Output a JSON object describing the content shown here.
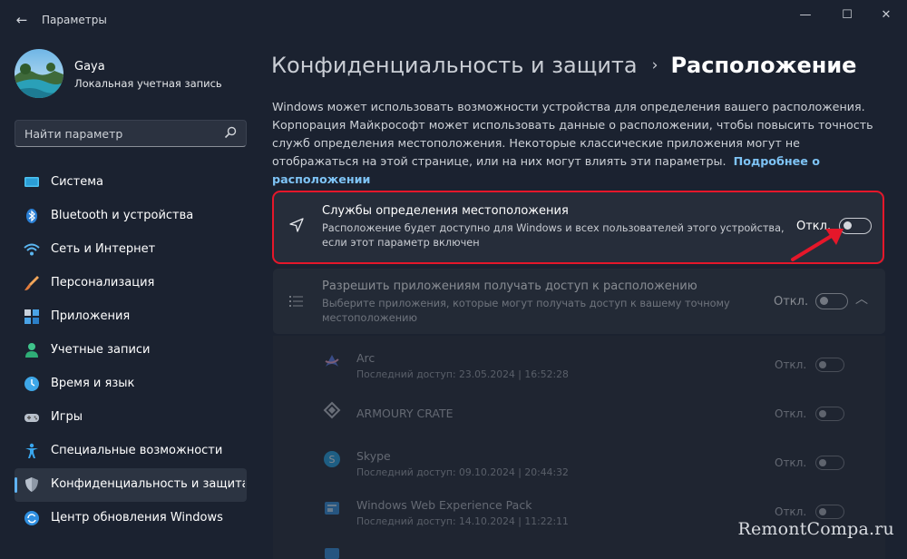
{
  "window": {
    "title": "Параметры",
    "controls": {
      "minimize": "—",
      "maximize": "☐",
      "close": "✕"
    }
  },
  "user": {
    "name": "Gaya",
    "account_type": "Локальная учетная запись"
  },
  "search": {
    "placeholder": "Найти параметр"
  },
  "sidebar": {
    "items": [
      {
        "label": "Система",
        "icon": "monitor-icon"
      },
      {
        "label": "Bluetooth и устройства",
        "icon": "bluetooth-icon"
      },
      {
        "label": "Сеть и Интернет",
        "icon": "wifi-icon"
      },
      {
        "label": "Персонализация",
        "icon": "brush-icon"
      },
      {
        "label": "Приложения",
        "icon": "apps-icon"
      },
      {
        "label": "Учетные записи",
        "icon": "person-icon"
      },
      {
        "label": "Время и язык",
        "icon": "globe-clock-icon"
      },
      {
        "label": "Игры",
        "icon": "gamepad-icon"
      },
      {
        "label": "Специальные возможности",
        "icon": "accessibility-icon"
      },
      {
        "label": "Конфиденциальность и защита",
        "icon": "shield-icon",
        "active": true
      },
      {
        "label": "Центр обновления Windows",
        "icon": "update-icon"
      }
    ]
  },
  "breadcrumb": {
    "parent": "Конфиденциальность и защита",
    "separator": "›",
    "current": "Расположение"
  },
  "intro": {
    "text": "Windows может использовать возможности устройства для определения вашего расположения. Корпорация Майкрософт может использовать данные о расположении, чтобы повысить точность служб определения местоположения. Некоторые классические приложения могут не отображаться на этой странице, или на них могут влиять эти параметры.",
    "link": "Подробнее о расположении"
  },
  "location_services": {
    "title": "Службы определения местоположения",
    "description_line1": "Расположение будет доступно для Windows и всех пользователей этого устройства,",
    "description_line2": "если этот параметр включен",
    "state_label": "Откл.",
    "enabled": false
  },
  "app_access": {
    "title": "Разрешить приложениям получать доступ к расположению",
    "description_line1": "Выберите приложения, которые могут получать доступ к вашему точному",
    "description_line2": "местоположению",
    "state_label": "Откл.",
    "enabled": false,
    "expanded": true
  },
  "apps": [
    {
      "name": "Arc",
      "last_access": "Последний доступ: 23.05.2024  |  16:52:28",
      "state": "Откл."
    },
    {
      "name": "ARMOURY CRATE",
      "last_access": "",
      "state": "Откл."
    },
    {
      "name": "Skype",
      "last_access": "Последний доступ: 09.10.2024  |  20:44:32",
      "state": "Откл."
    },
    {
      "name": "Windows Web Experience Pack",
      "last_access": "Последний доступ: 14.10.2024  |  11:22:11",
      "state": "Откл."
    }
  ],
  "watermark": "RemontCompa.ru",
  "colors": {
    "accent": "#5fb2f2",
    "highlight_border": "#e5172a",
    "background": "#1b2230"
  }
}
